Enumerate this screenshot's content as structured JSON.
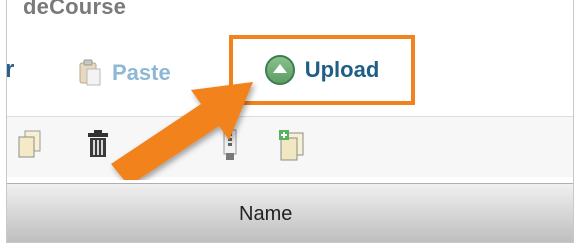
{
  "course": {
    "title_fragment": "deCourse"
  },
  "tabs": {
    "partial_label": "r",
    "paste_label": "Paste",
    "upload_label": "Upload"
  },
  "toolbar": {
    "icons": [
      "copy-icon",
      "trash-icon",
      "upload-icon",
      "zip-icon",
      "new-file-icon"
    ]
  },
  "table": {
    "columns": [
      "Name"
    ]
  },
  "colors": {
    "highlight": "#f2821e",
    "upload_tab_text": "#1f5f86",
    "paste_tab_text": "#8fb8d6"
  }
}
